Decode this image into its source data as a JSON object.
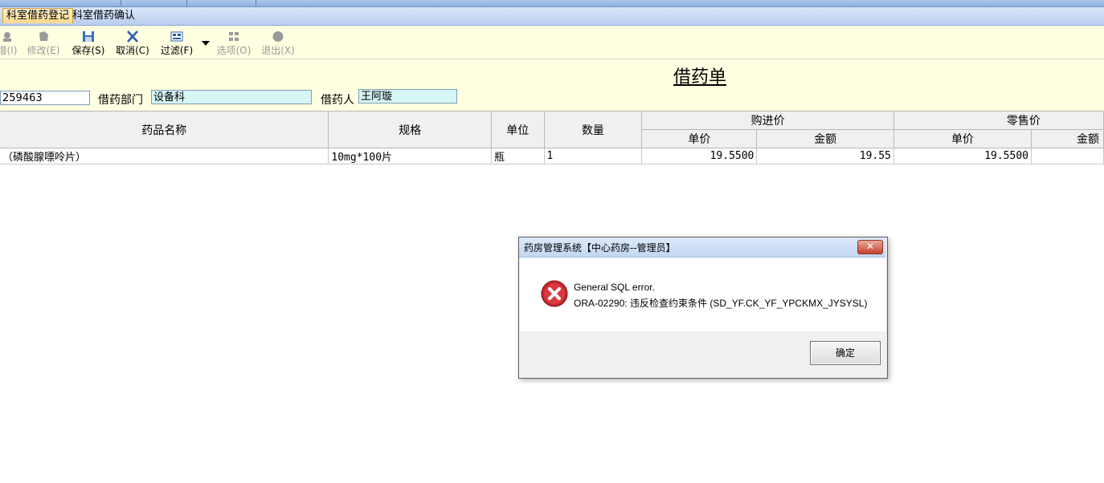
{
  "tabs": [
    {
      "label": "科室借药登记"
    },
    {
      "label": "科室借药确认"
    }
  ],
  "toolbar": {
    "new_label": "增(I)",
    "modify_label": "修改(E)",
    "save_label": "保存(S)",
    "cancel_label": "取消(C)",
    "filter_label": "过滤(F)",
    "options_label": "选项(O)",
    "exit_label": "退出(X)"
  },
  "form": {
    "title": "借药单",
    "doc_no": "259463",
    "dept_label": "借药部门",
    "dept_value": "设备科",
    "person_label": "借药人",
    "person_value": "王阿璇"
  },
  "grid": {
    "headers": {
      "name": "药品名称",
      "spec": "规格",
      "unit": "单位",
      "qty": "数量",
      "purchase_group": "购进价",
      "retail_group": "零售价",
      "purchase_price": "单价",
      "purchase_amount": "金额",
      "retail_price": "单价",
      "retail_amount": "金额"
    },
    "rows": [
      {
        "name": "（磷酸腺嘌呤片）",
        "spec": "10mg*100片",
        "unit": "瓶",
        "qty": "1",
        "purchase_price": "19.5500",
        "purchase_amount": "19.55",
        "retail_price": "19.5500",
        "retail_amount": ""
      }
    ]
  },
  "dialog": {
    "title": "药房管理系统【中心药房--管理员】",
    "line1": "General SQL error.",
    "line2": "ORA-02290: 违反检查约束条件 (SD_YF.CK_YF_YPCKMX_JYSYSL)",
    "ok_label": "确定",
    "close_label": "✕"
  }
}
